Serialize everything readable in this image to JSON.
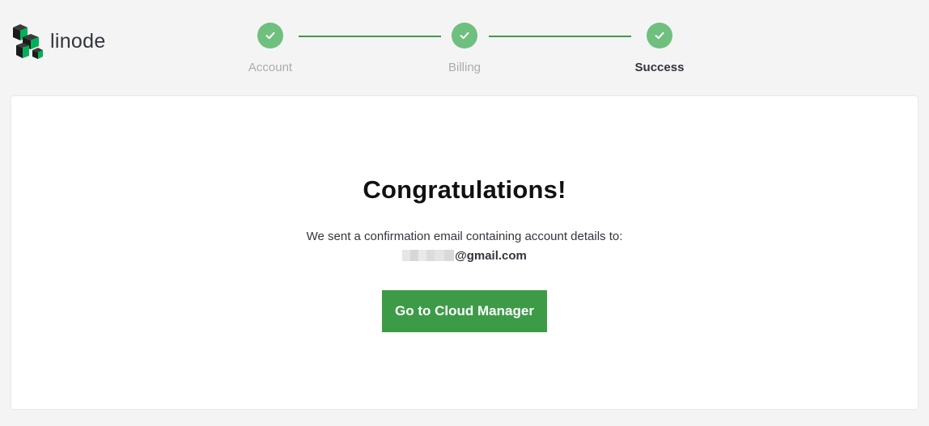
{
  "brand": {
    "name": "linode",
    "logo_icon": "linode-cubes-logo"
  },
  "steps": [
    {
      "label": "Account",
      "status": "complete",
      "icon": "check-icon"
    },
    {
      "label": "Billing",
      "status": "complete",
      "icon": "check-icon"
    },
    {
      "label": "Success",
      "status": "current",
      "icon": "check-icon"
    }
  ],
  "colors": {
    "accent_green": "#3d9b48",
    "step_circle": "#6fbf7e",
    "background": "#f4f4f4",
    "card": "#ffffff"
  },
  "main": {
    "title": "Congratulations!",
    "message": "We sent a confirmation email containing account details to:",
    "email_domain": "@gmail.com",
    "cta_label": "Go to Cloud Manager"
  }
}
